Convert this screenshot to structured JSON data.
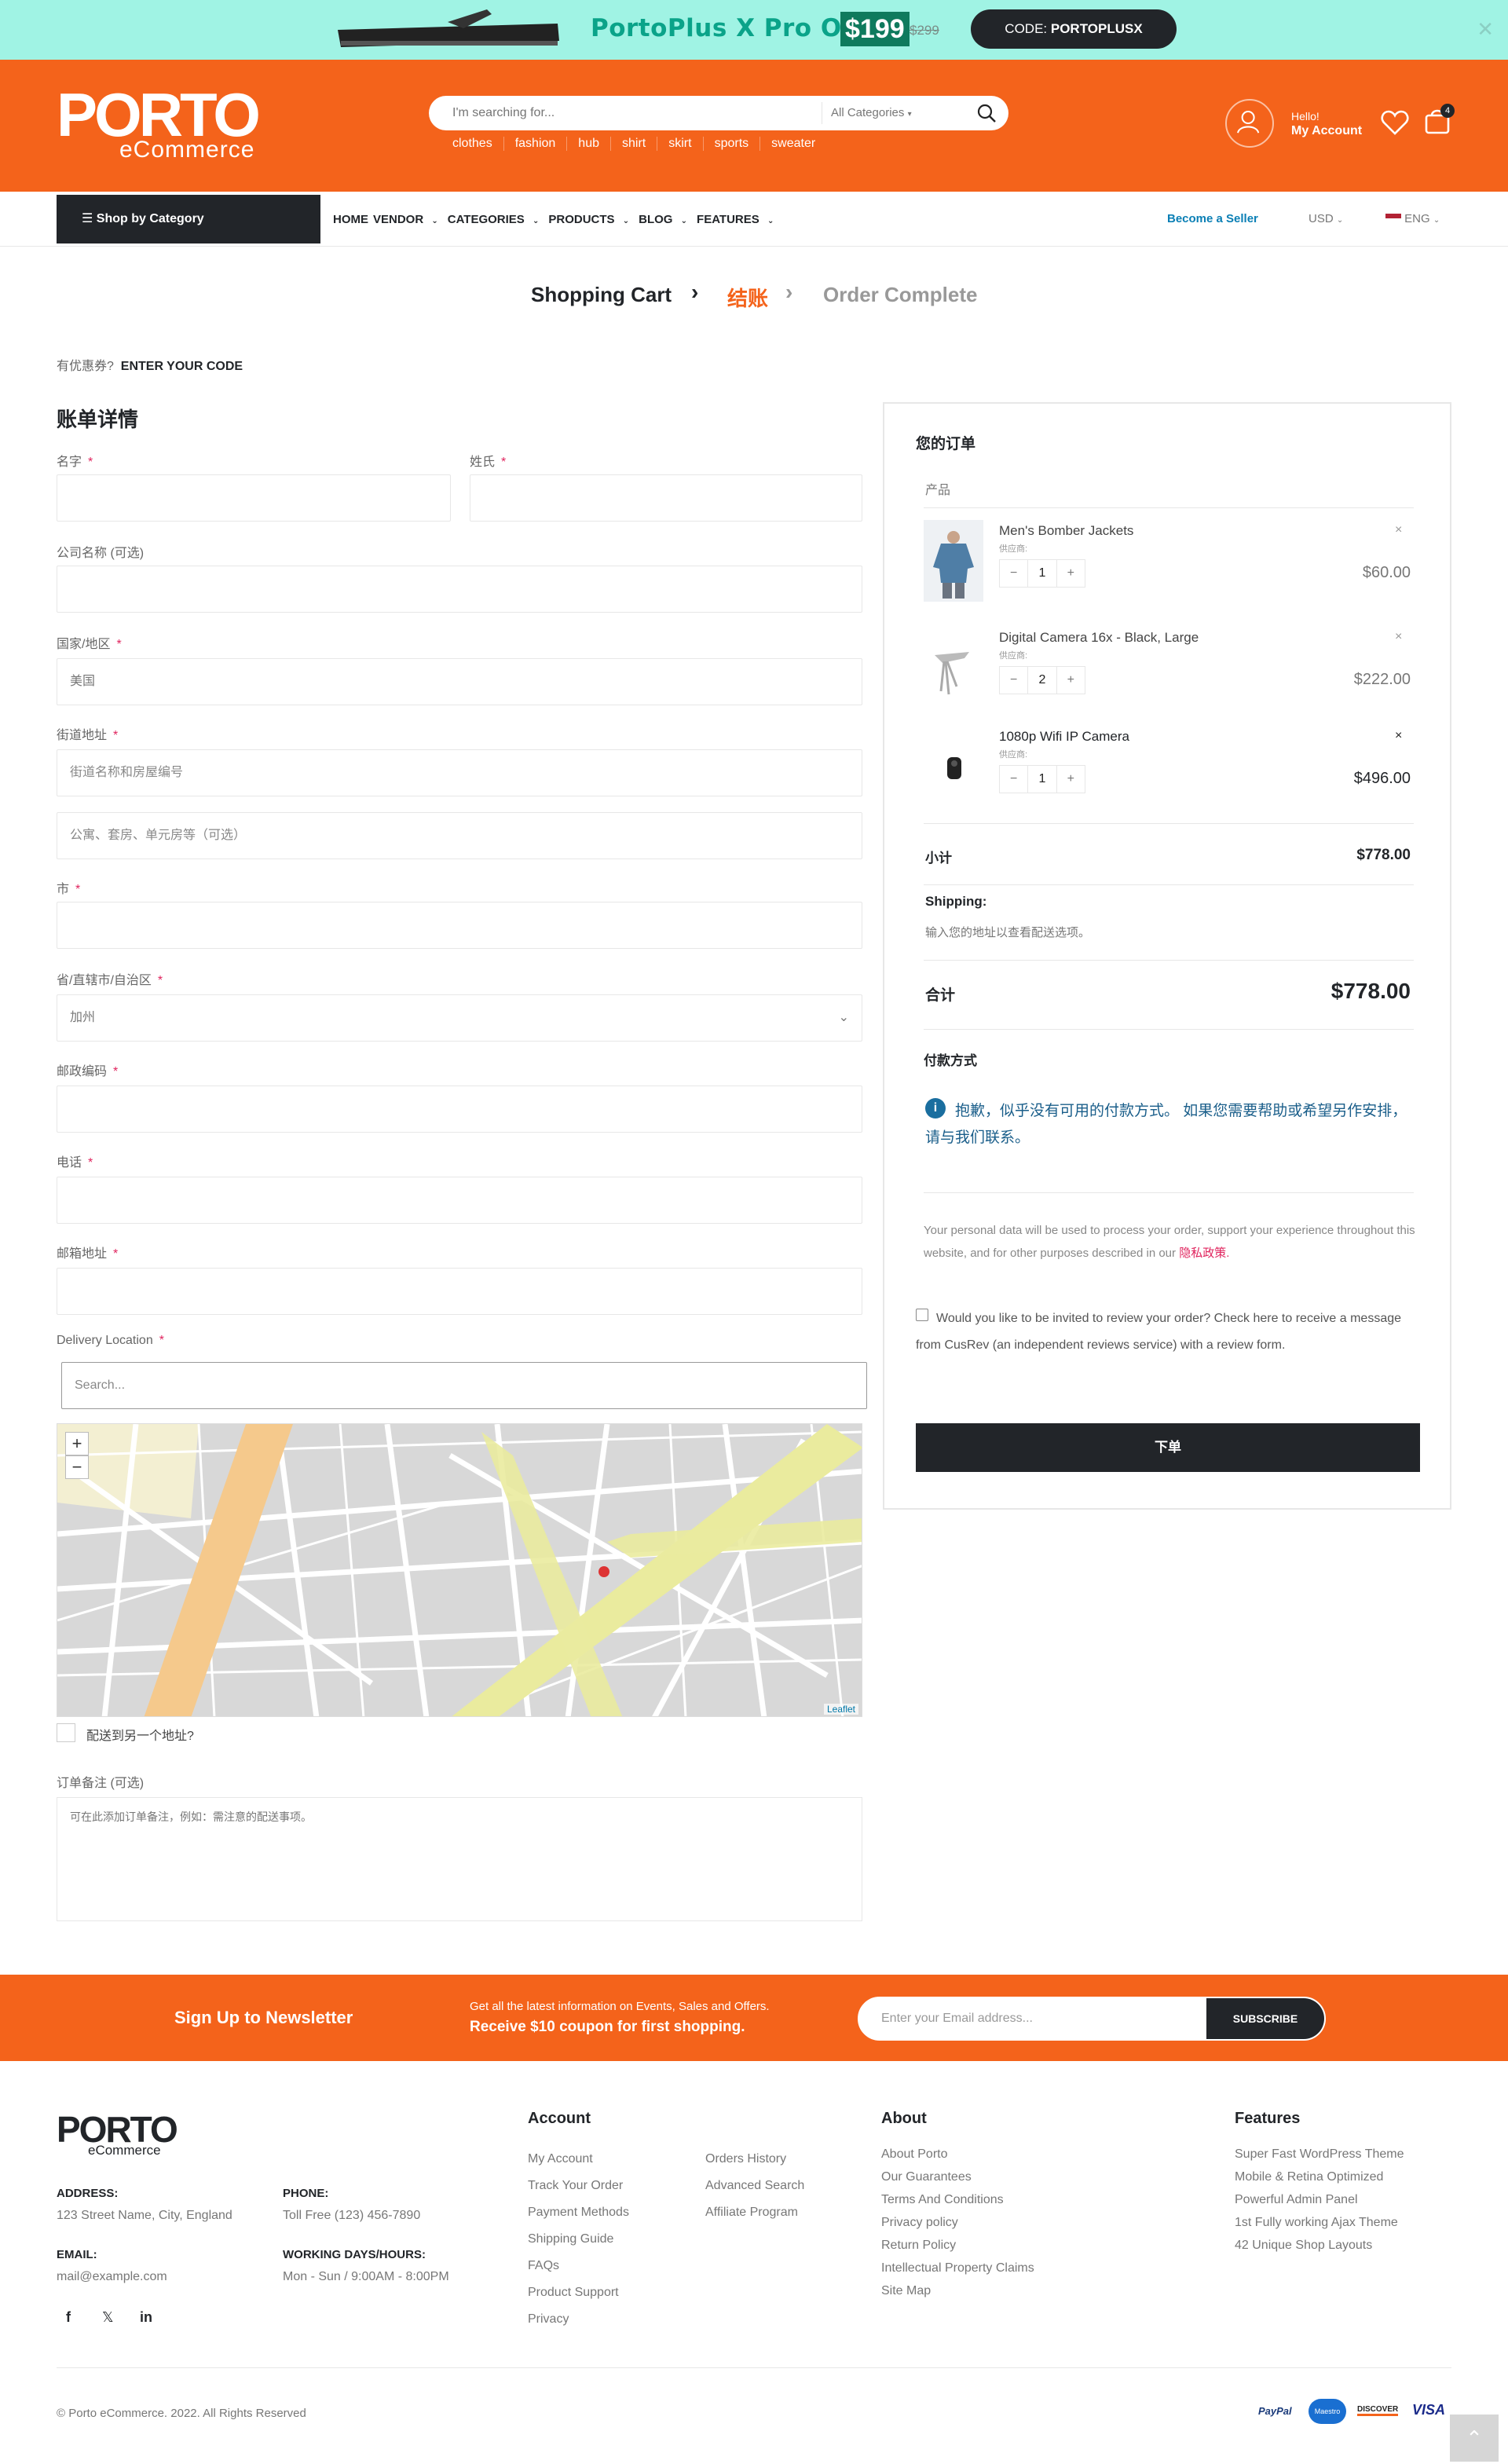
{
  "promo": {
    "text": "PortoPlus X Pro Only",
    "price": "$199",
    "old_price": "$299",
    "code_label": "CODE:",
    "code": "PORTOPLUSX"
  },
  "header": {
    "logo_main": "PORTO",
    "logo_sub": "eCommerce",
    "search_placeholder": "I'm searching for...",
    "category_select": "All Categories",
    "quick_links": [
      "clothes",
      "fashion",
      "hub",
      "shirt",
      "skirt",
      "sports",
      "sweater"
    ],
    "hello": "Hello!",
    "my_account": "My Account",
    "cart_count": "4"
  },
  "nav": {
    "shop_by_category": "Shop by Category",
    "menu": [
      "HOME",
      "VENDOR",
      "CATEGORIES",
      "PRODUCTS",
      "BLOG",
      "FEATURES"
    ],
    "become_seller": "Become a Seller",
    "currency": "USD",
    "language": "ENG"
  },
  "steps": {
    "cart": "Shopping Cart",
    "checkout": "结账",
    "complete": "Order Complete"
  },
  "coupon": {
    "question": "有优惠券?",
    "link": "ENTER YOUR CODE"
  },
  "billing": {
    "title": "账单详情",
    "first_name": "名字",
    "last_name": "姓氏",
    "company": "公司名称 (可选)",
    "country": "国家/地区",
    "country_value": "美国",
    "street": "街道地址",
    "street_placeholder": "街道名称和房屋编号",
    "street2_placeholder": "公寓、套房、单元房等（可选）",
    "city": "市",
    "state": "省/直辖市/自治区",
    "state_value": "加州",
    "postcode": "邮政编码",
    "phone": "电话",
    "email": "邮箱地址",
    "delivery_location": "Delivery Location",
    "delivery_placeholder": "Search...",
    "ship_different": "配送到另一个地址?",
    "notes_label": "订单备注 (可选)",
    "notes_placeholder": "可在此添加订单备注，例如：需注意的配送事项。",
    "map_attribution": "Leaflet"
  },
  "order": {
    "title": "您的订单",
    "product_header": "产品",
    "vendor_label": "供应商:",
    "items": [
      {
        "name": "Men's Bomber Jackets",
        "qty": "1",
        "price": "$60.00"
      },
      {
        "name": "Digital Camera 16x - Black, Large",
        "qty": "2",
        "price": "$222.00"
      },
      {
        "name": "1080p Wifi IP Camera",
        "qty": "1",
        "price": "$496.00"
      }
    ],
    "subtotal_label": "小计",
    "subtotal": "$778.00",
    "shipping_label": "Shipping:",
    "shipping_note": "输入您的地址以查看配送选项。",
    "total_label": "合计",
    "total": "$778.00",
    "payment_title": "付款方式",
    "payment_notice": "抱歉，似乎没有可用的付款方式。 如果您需要帮助或希望另作安排，请与我们联系。",
    "privacy_text": "Your personal data will be used to process your order, support your experience throughout this website, and for other purposes described in our",
    "privacy_link": "隐私政策.",
    "review_text": "Would you like to be invited to review your order? Check here to receive a message from CusRev (an independent reviews service) with a review form.",
    "place_order": "下单"
  },
  "newsletter": {
    "title": "Sign Up to Newsletter",
    "line1": "Get all the latest information on Events, Sales and Offers.",
    "line2": "Receive $10 coupon for first shopping.",
    "placeholder": "Enter your Email address...",
    "button": "SUBSCRIBE"
  },
  "footer": {
    "logo_main": "PORTO",
    "logo_sub": "eCommerce",
    "address_label": "ADDRESS:",
    "address": "123 Street Name, City, England",
    "phone_label": "PHONE:",
    "phone": "Toll Free (123) 456-7890",
    "email_label": "EMAIL:",
    "email": "mail@example.com",
    "hours_label": "WORKING DAYS/HOURS:",
    "hours": "Mon - Sun / 9:00AM - 8:00PM",
    "account_title": "Account",
    "account_col1": [
      "My Account",
      "Track Your Order",
      "Payment Methods",
      "Shipping Guide",
      "FAQs",
      "Product Support",
      "Privacy"
    ],
    "account_col2": [
      "Orders History",
      "Advanced Search",
      "Affiliate Program"
    ],
    "about_title": "About",
    "about_links": [
      "About Porto",
      "Our Guarantees",
      "Terms And Conditions",
      "Privacy policy",
      "Return Policy",
      "Intellectual Property Claims",
      "Site Map"
    ],
    "features_title": "Features",
    "features_links": [
      "Super Fast WordPress Theme",
      "Mobile & Retina Optimized",
      "Powerful Admin Panel",
      "1st Fully working Ajax Theme",
      "42 Unique Shop Layouts"
    ],
    "copyright": "© Porto eCommerce. 2022. All Rights Reserved",
    "payments": [
      "PayPal",
      "Maestro",
      "DISCOVER",
      "VISA"
    ]
  },
  "colors": {
    "brand": "#f4631b",
    "dark": "#222529",
    "promo_bg": "#a0f3e4",
    "promo_text": "#0aa389",
    "notice_icon": "#0088cc"
  }
}
